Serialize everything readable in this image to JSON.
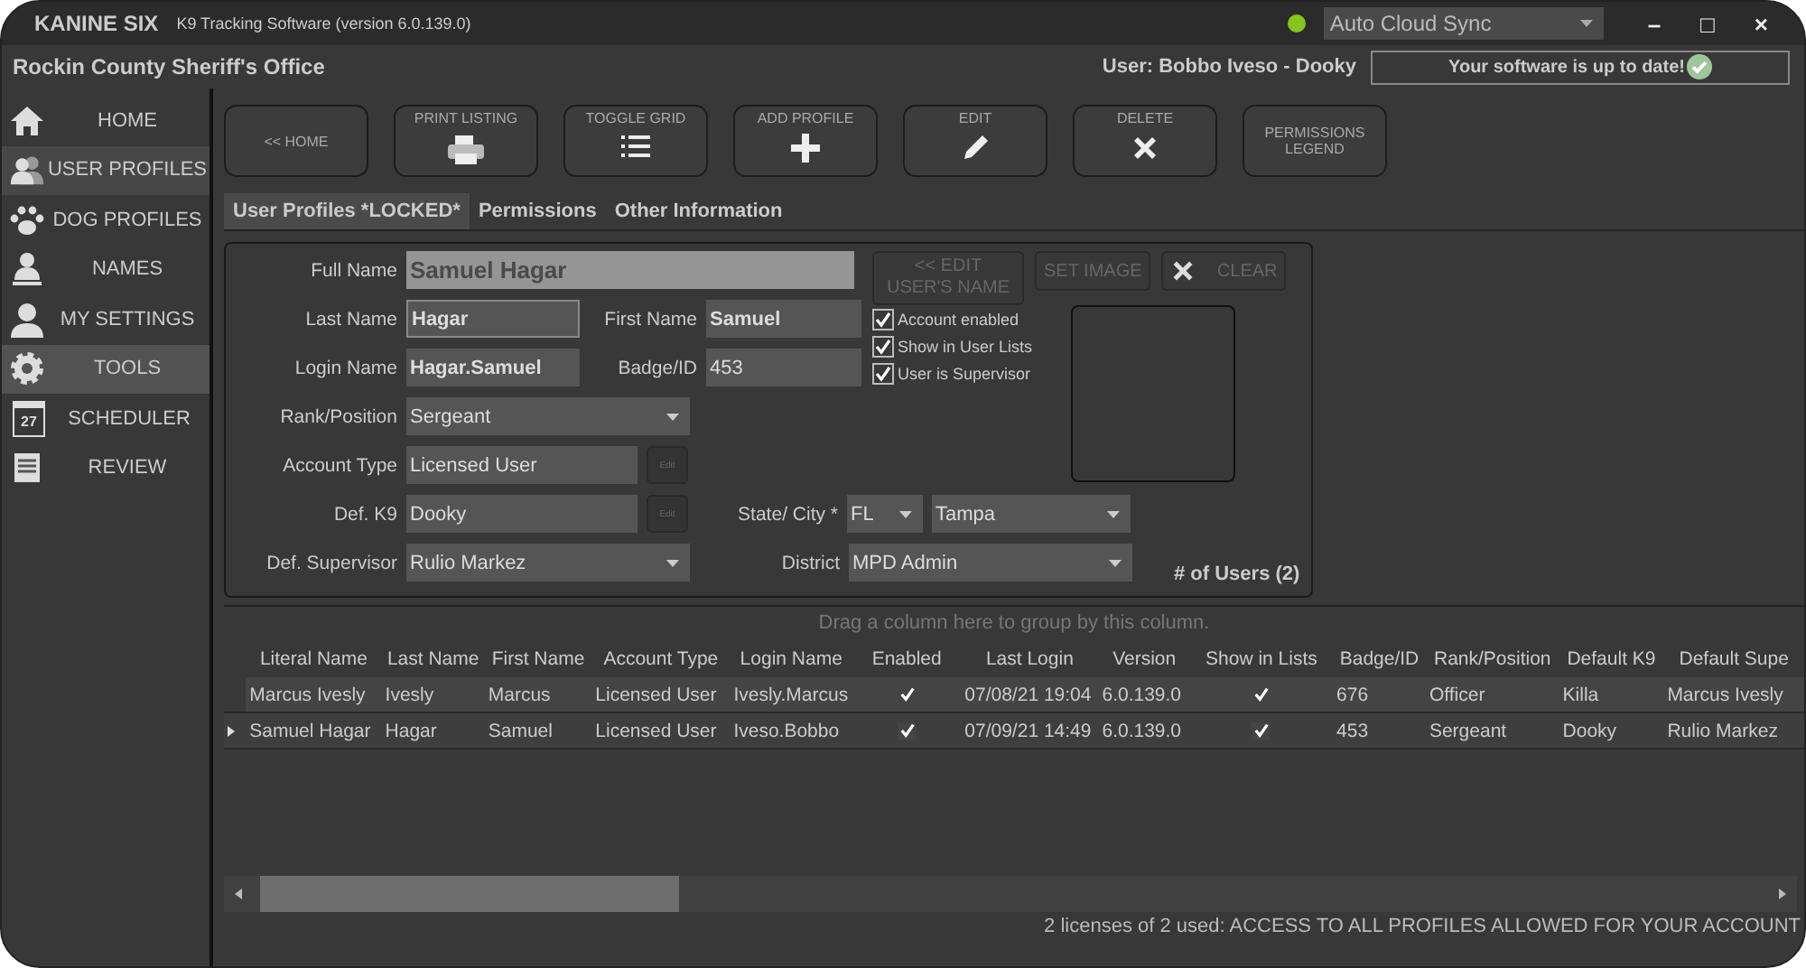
{
  "window": {
    "app_name": "KANINE SIX",
    "subtitle": "K9 Tracking Software (version 6.0.139.0)",
    "online": true,
    "sync": "Auto Cloud Sync",
    "minimize": "–",
    "maximize": "□",
    "close": "×"
  },
  "header": {
    "office": "Rockin County Sheriff's Office",
    "user": "User: Bobbo Iveso - Dooky",
    "update_status": "Your software is up to date!"
  },
  "sidebar": {
    "items": [
      {
        "label": "HOME",
        "kind": "home",
        "selected": false,
        "highlighted": false
      },
      {
        "label": "USER PROFILES",
        "kind": "users",
        "selected": true,
        "highlighted": false
      },
      {
        "label": "DOG PROFILES",
        "kind": "paw",
        "selected": false,
        "highlighted": false
      },
      {
        "label": "NAMES",
        "kind": "stamp",
        "selected": false,
        "highlighted": false
      },
      {
        "label": "MY SETTINGS",
        "kind": "person",
        "selected": false,
        "highlighted": false
      },
      {
        "label": "TOOLS",
        "kind": "gear",
        "selected": false,
        "highlighted": true
      },
      {
        "label": "SCHEDULER",
        "kind": "calendar",
        "day": "27",
        "selected": false,
        "highlighted": false
      },
      {
        "label": "REVIEW",
        "kind": "document",
        "selected": false,
        "highlighted": false
      }
    ]
  },
  "toolbar": [
    {
      "label": "<< HOME",
      "kind": "plain"
    },
    {
      "label": "PRINT LISTING",
      "kind": "printer"
    },
    {
      "label": "TOGGLE GRID",
      "kind": "list"
    },
    {
      "label": "ADD PROFILE",
      "kind": "plus"
    },
    {
      "label": "EDIT",
      "kind": "pencil"
    },
    {
      "label": "DELETE",
      "kind": "x"
    },
    {
      "label": "PERMISSIONS LEGEND",
      "kind": "plain"
    }
  ],
  "tabs": [
    {
      "label": "User Profiles *LOCKED*",
      "selected": true
    },
    {
      "label": "Permissions",
      "selected": false
    },
    {
      "label": "Other Information",
      "selected": false
    }
  ],
  "form": {
    "full_name": {
      "label": "Full Name",
      "value": "Samuel Hagar"
    },
    "last_name": {
      "label": "Last Name",
      "value": "Hagar"
    },
    "first_name": {
      "label": "First Name",
      "value": "Samuel"
    },
    "login_name": {
      "label": "Login Name",
      "value": "Hagar.Samuel"
    },
    "badge": {
      "label": "Badge/ID",
      "value": "453"
    },
    "rank": {
      "label": "Rank/Position",
      "value": "Sergeant"
    },
    "account_type": {
      "label": "Account Type",
      "value": "Licensed User",
      "button": "Edit"
    },
    "def_k9": {
      "label": "Def. K9",
      "value": "Dooky",
      "button": "Edit"
    },
    "def_supervisor": {
      "label": "Def. Supervisor",
      "value": "Rulio Markez"
    },
    "state_city": {
      "label": "State/ City *",
      "state": "FL",
      "city": "Tampa"
    },
    "district": {
      "label": "District",
      "value": "MPD Admin"
    },
    "edit_name_button": "<< EDIT USER'S NAME",
    "set_image_button": "SET IMAGE",
    "clear_button": "CLEAR",
    "checkboxes": [
      {
        "label": "Account enabled",
        "checked": true
      },
      {
        "label": "Show in User Lists",
        "checked": true
      },
      {
        "label": "User is Supervisor",
        "checked": true
      }
    ],
    "user_count": "# of Users (2)"
  },
  "table": {
    "group_hint": "Drag a column here to group by this column.",
    "columns": [
      "Literal Name",
      "Last Name",
      "First Name",
      "Account Type",
      "Login Name",
      "Enabled",
      "Last Login",
      "Version",
      "Show in Lists",
      "Badge/ID",
      "Rank/Position",
      "Default K9",
      "Default Supe"
    ],
    "rows": [
      {
        "current": false,
        "literal_name": "Marcus Ivesly",
        "last_name": "Ivesly",
        "first_name": "Marcus",
        "account_type": "Licensed User",
        "login_name": "Ivesly.Marcus",
        "enabled": true,
        "last_login": "07/08/21 19:04",
        "version": "6.0.139.0",
        "show_in_lists": true,
        "badge": "676",
        "rank": "Officer",
        "default_k9": "Killa",
        "default_supervisor": "Marcus Ivesly"
      },
      {
        "current": true,
        "literal_name": "Samuel Hagar",
        "last_name": "Hagar",
        "first_name": "Samuel",
        "account_type": "Licensed User",
        "login_name": "Iveso.Bobbo",
        "enabled": true,
        "last_login": "07/09/21 14:49",
        "version": "6.0.139.0",
        "show_in_lists": true,
        "badge": "453",
        "rank": "Sergeant",
        "default_k9": "Dooky",
        "default_supervisor": "Rulio Markez"
      }
    ]
  },
  "status_bar": "2 licenses of 2 used: ACCESS TO ALL PROFILES ALLOWED FOR YOUR ACCOUNT"
}
